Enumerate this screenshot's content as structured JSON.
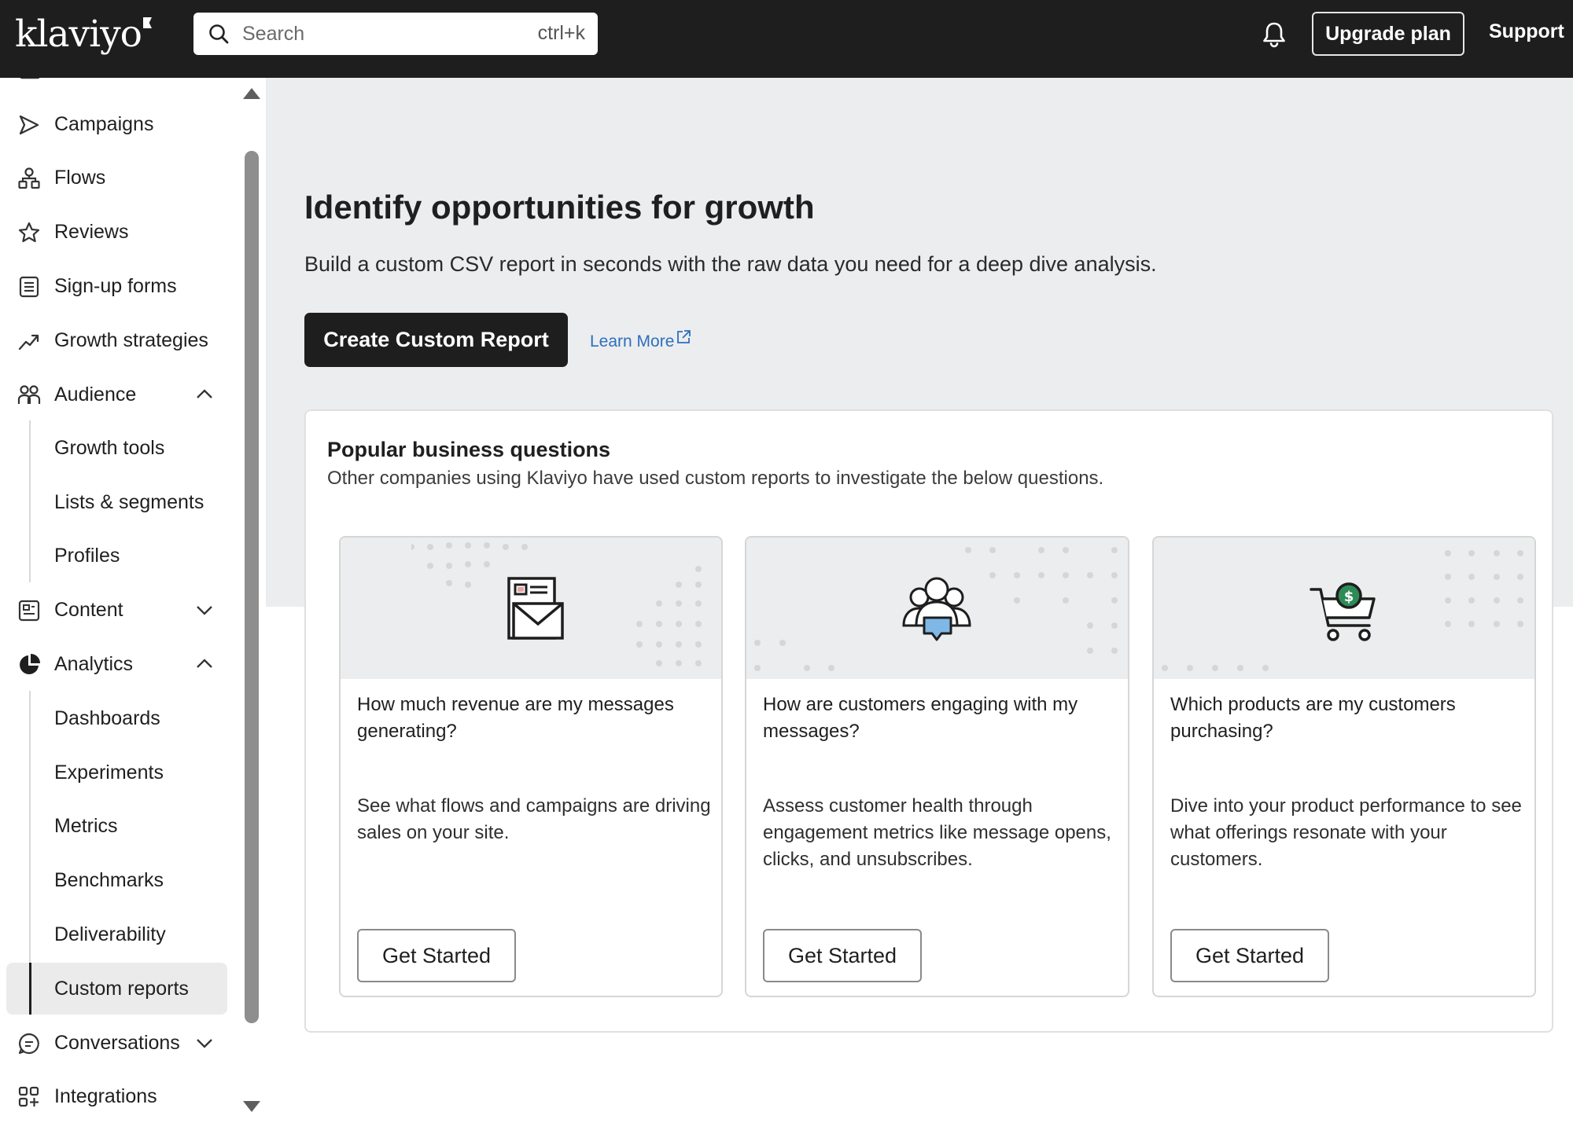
{
  "app": {
    "logo": "klaviyo"
  },
  "search": {
    "placeholder": "Search",
    "shortcut": "ctrl+k"
  },
  "header": {
    "upgrade_label": "Upgrade plan",
    "support_label": "Support"
  },
  "sidebar": {
    "items": [
      {
        "label": "Campaigns",
        "icon": "send-icon"
      },
      {
        "label": "Flows",
        "icon": "flows-icon"
      },
      {
        "label": "Reviews",
        "icon": "star-icon"
      },
      {
        "label": "Sign-up forms",
        "icon": "form-icon"
      },
      {
        "label": "Growth strategies",
        "icon": "trend-icon"
      },
      {
        "label": "Audience",
        "icon": "people-icon",
        "expanded": true
      },
      {
        "label": "Content",
        "icon": "content-icon",
        "expanded": false
      },
      {
        "label": "Analytics",
        "icon": "pie-chart-icon",
        "expanded": true
      },
      {
        "label": "Conversations",
        "icon": "chat-icon",
        "expanded": false
      },
      {
        "label": "Integrations",
        "icon": "integrations-icon"
      }
    ],
    "audience_sub": [
      "Growth tools",
      "Lists & segments",
      "Profiles"
    ],
    "analytics_sub": [
      "Dashboards",
      "Experiments",
      "Metrics",
      "Benchmarks",
      "Deliverability",
      "Custom reports"
    ],
    "active": "Custom reports"
  },
  "main": {
    "title": "Identify opportunities for growth",
    "subtitle": "Build a custom CSV report in seconds with the raw data you need for a deep dive analysis.",
    "cta_label": "Create Custom Report",
    "learn_more": "Learn More"
  },
  "questions": {
    "title": "Popular business questions",
    "subtitle": "Other companies using Klaviyo have used custom reports to investigate the below questions.",
    "cards": [
      {
        "icon": "newsletter-icon",
        "question": "How much revenue are my messages generating?",
        "description": "See what flows and campaigns are driving sales on your site.",
        "button": "Get Started"
      },
      {
        "icon": "audience-chat-icon",
        "question": "How are customers engaging with my messages?",
        "description": "Assess customer health through engagement metrics like message opens, clicks, and unsubscribes.",
        "button": "Get Started"
      },
      {
        "icon": "shopping-cart-icon",
        "question": "Which products are my customers purchasing?",
        "description": "Dive into your product performance to see what offerings resonate with your customers.",
        "button": "Get Started"
      }
    ]
  },
  "colors": {
    "topbar": "#1e1e1e",
    "accent_link": "#2e6fbf",
    "money": "#2e8b57",
    "chat_bubble": "#7fb8e6"
  }
}
